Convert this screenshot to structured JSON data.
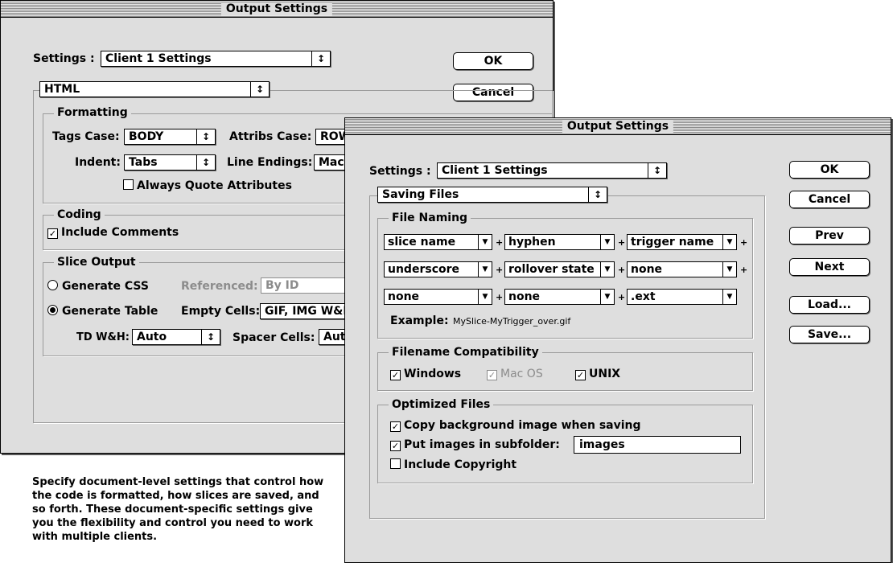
{
  "back_window": {
    "title": "Output Settings",
    "settings_label": "Settings :",
    "settings_value": "Client 1 Settings",
    "ok_label": "OK",
    "cancel_label": "Cancel",
    "section_value": "HTML",
    "formatting": {
      "title": "Formatting",
      "tags_case_label": "Tags Case:",
      "tags_case_value": "BODY",
      "attribs_case_label": "Attribs Case:",
      "attribs_case_value": "ROW",
      "indent_label": "Indent:",
      "indent_value": "Tabs",
      "line_endings_label": "Line Endings:",
      "line_endings_value": "Mac",
      "always_quote_label": "Always Quote Attributes",
      "always_quote_checked": false
    },
    "coding": {
      "title": "Coding",
      "include_comments_label": "Include Comments",
      "include_comments_checked": true
    },
    "slice_output": {
      "title": "Slice Output",
      "generate_css_label": "Generate CSS",
      "referenced_label": "Referenced:",
      "referenced_value": "By ID",
      "generate_table_label": "Generate Table",
      "empty_cells_label": "Empty Cells:",
      "empty_cells_value": "GIF, IMG W&H",
      "td_wh_label": "TD W&H:",
      "td_wh_value": "Auto",
      "spacer_cells_label": "Spacer Cells:",
      "spacer_cells_value": "Auto",
      "selected": "Generate Table"
    }
  },
  "front_window": {
    "title": "Output Settings",
    "settings_label": "Settings :",
    "settings_value": "Client 1 Settings",
    "section_value": "Saving Files",
    "buttons": {
      "ok": "OK",
      "cancel": "Cancel",
      "prev": "Prev",
      "next": "Next",
      "load": "Load...",
      "save": "Save..."
    },
    "file_naming": {
      "title": "File Naming",
      "rows": [
        [
          "slice name",
          "hyphen",
          "trigger name"
        ],
        [
          "underscore",
          "rollover state",
          "none"
        ],
        [
          "none",
          "none",
          ".ext"
        ]
      ],
      "plus": "+",
      "example_label": "Example:",
      "example_value": "MySlice-MyTrigger_over.gif"
    },
    "compat": {
      "title": "Filename Compatibility",
      "windows_label": "Windows",
      "windows_checked": true,
      "macos_label": "Mac OS",
      "macos_checked": true,
      "unix_label": "UNIX",
      "unix_checked": true
    },
    "optimized": {
      "title": "Optimized Files",
      "copy_bg_label": "Copy background image when saving",
      "copy_bg_checked": true,
      "subfolder_label": "Put images in subfolder:",
      "subfolder_checked": true,
      "subfolder_value": "images",
      "copyright_label": "Include Copyright",
      "copyright_checked": false
    }
  },
  "caption": "Specify document-level settings that control how the code is formatted, how slices are saved, and so forth. These document-specific settings give you the flexibility and control you need to work with multiple clients.",
  "icons": {
    "popup_arrow": "↕",
    "small_arrow": "▼",
    "check": "✓"
  }
}
